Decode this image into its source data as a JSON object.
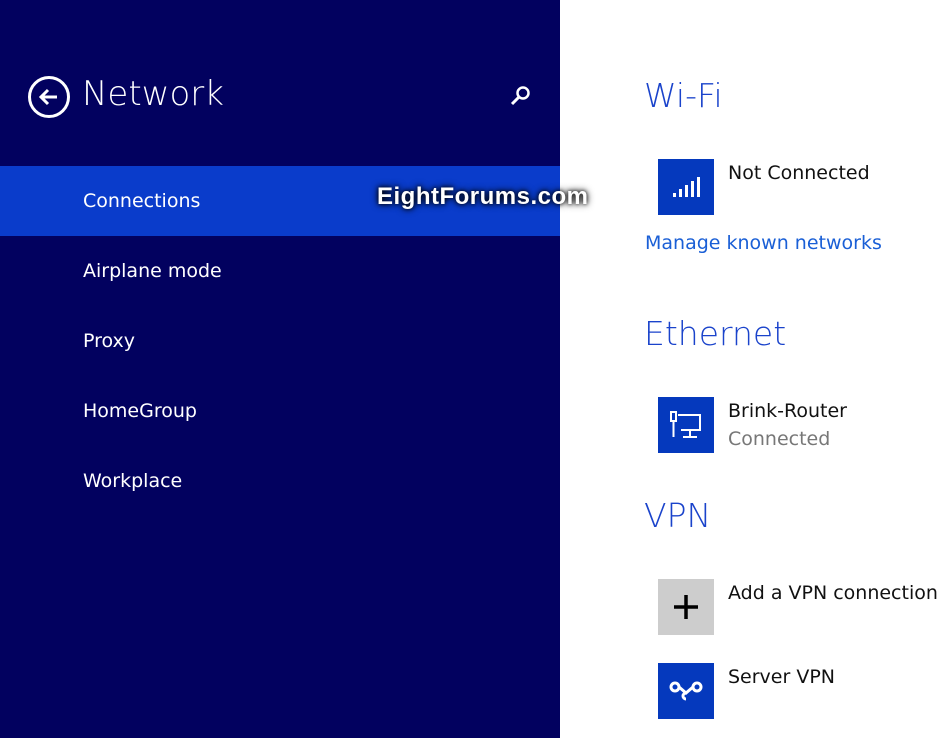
{
  "header": {
    "title": "Network",
    "back_icon": "back-arrow-icon",
    "search_icon": "search-icon"
  },
  "sidebar": {
    "items": [
      {
        "label": "Connections",
        "selected": true
      },
      {
        "label": "Airplane mode"
      },
      {
        "label": "Proxy"
      },
      {
        "label": "HomeGroup"
      },
      {
        "label": "Workplace"
      }
    ]
  },
  "watermark": "EightForums.com",
  "wifi": {
    "heading": "Wi-Fi",
    "status": "Not Connected",
    "manage_link": "Manage known networks"
  },
  "ethernet": {
    "heading": "Ethernet",
    "name": "Brink-Router",
    "status": "Connected"
  },
  "vpn": {
    "heading": "VPN",
    "add_label": "Add a VPN connection",
    "item": "Server VPN"
  },
  "colors": {
    "sidebar": "#02015f",
    "selected": "#0a3ccb",
    "tile": "#0539bd",
    "heading": "#1a43cb",
    "link": "#1a5fd6"
  }
}
